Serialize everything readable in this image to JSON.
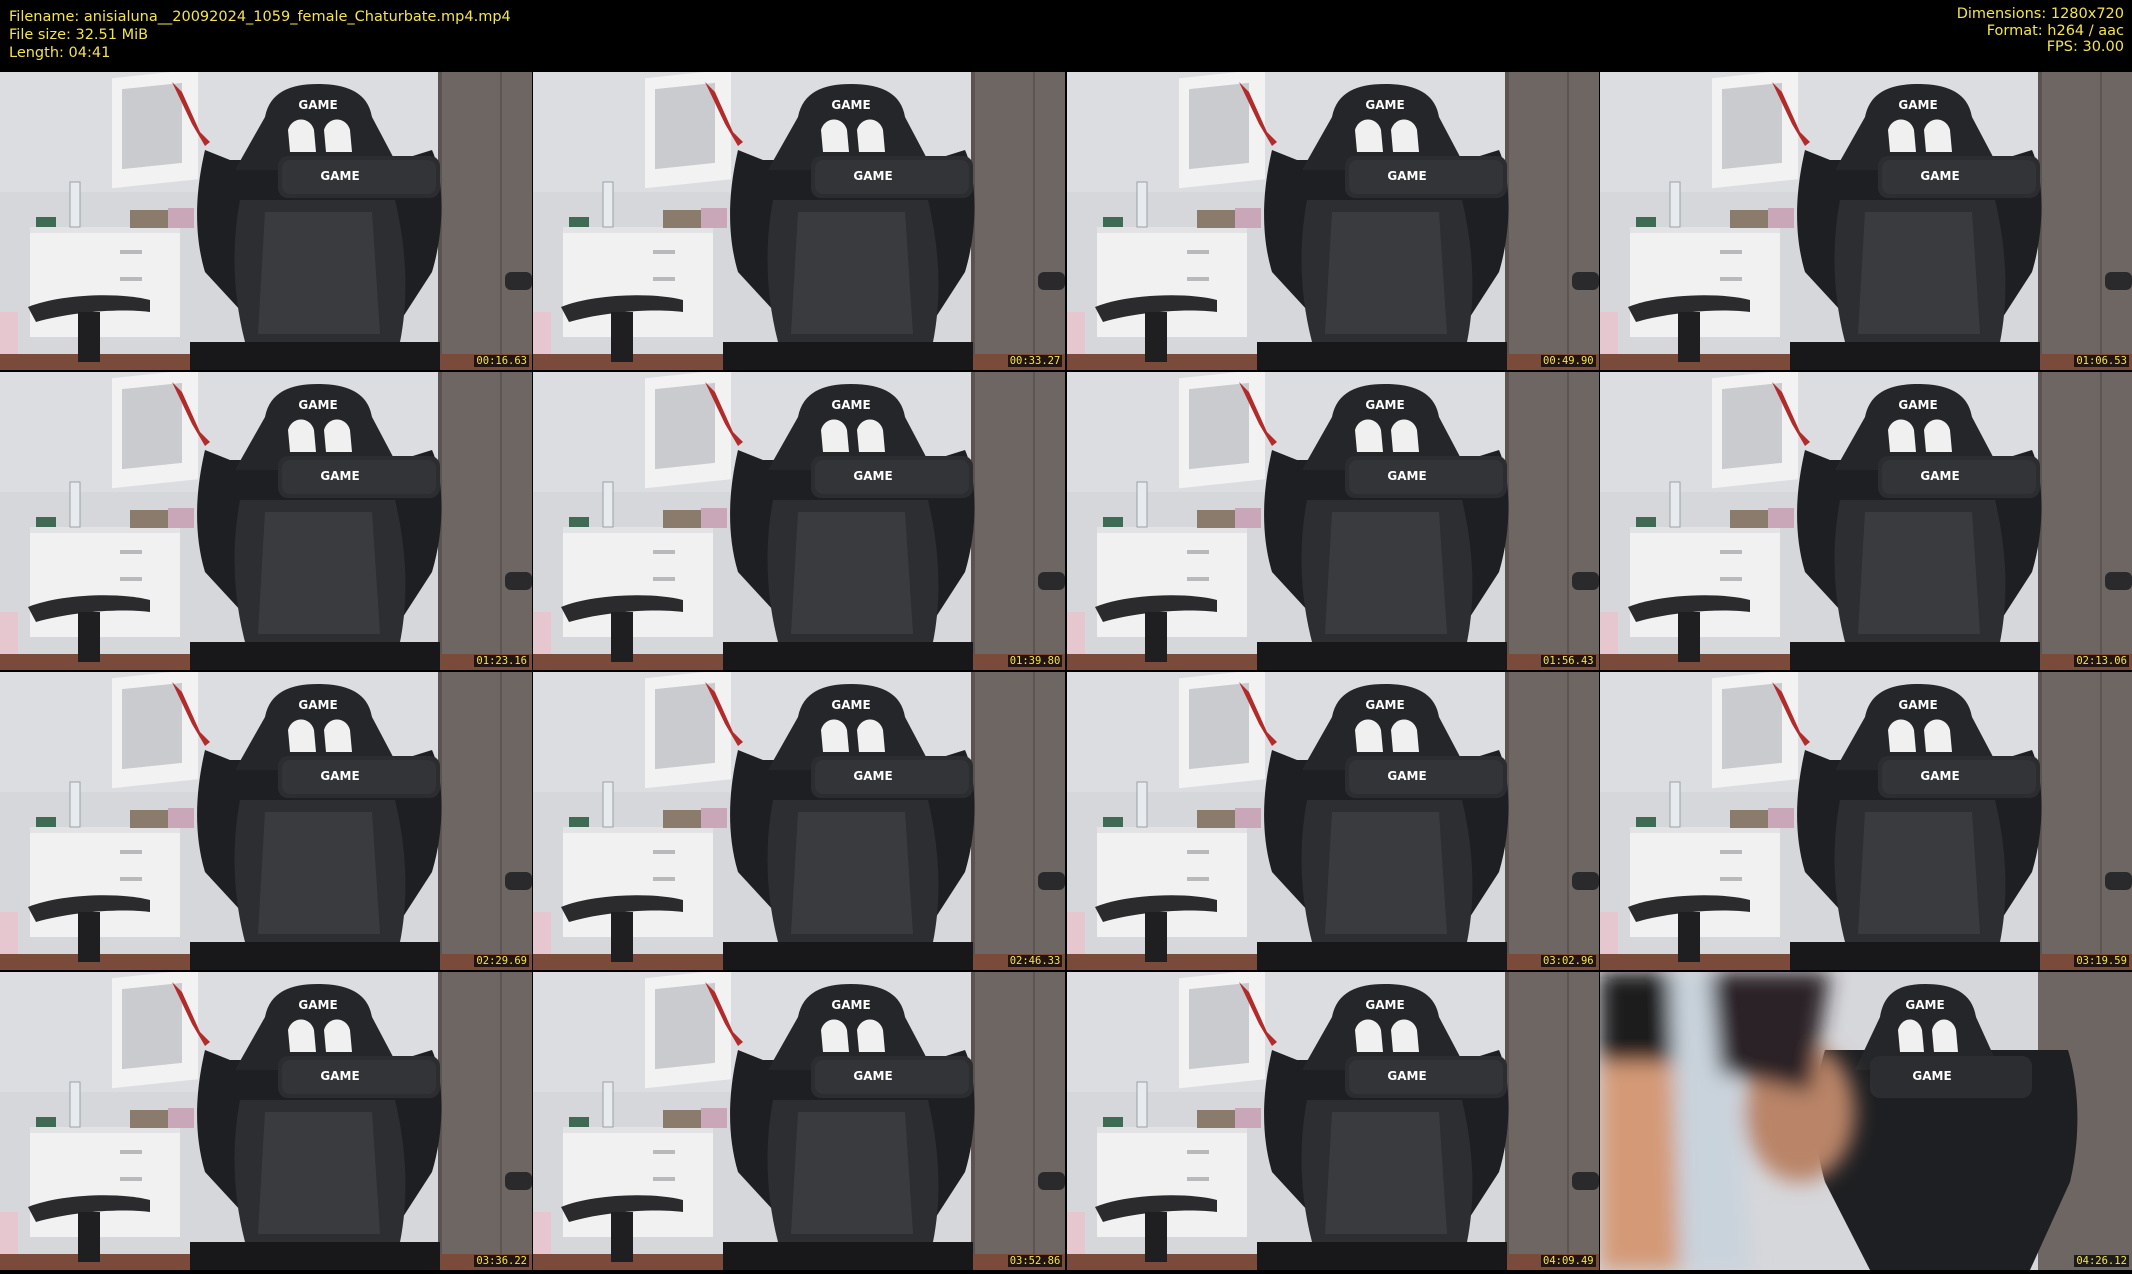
{
  "header": {
    "filename": "Filename: anisialuna__20092024_1059_female_Chaturbate.mp4.mp4",
    "filesize": "File size: 32.51 MiB",
    "length": "Length: 04:41",
    "dimensions": "Dimensions: 1280x720",
    "format": "Format: h264 / aac",
    "fps": "FPS: 30.00"
  },
  "frames": [
    {
      "time": "00:16.63",
      "variant": "chair"
    },
    {
      "time": "00:33.27",
      "variant": "chair"
    },
    {
      "time": "00:49.90",
      "variant": "chair"
    },
    {
      "time": "01:06.53",
      "variant": "chair"
    },
    {
      "time": "01:23.16",
      "variant": "chair"
    },
    {
      "time": "01:39.80",
      "variant": "chair"
    },
    {
      "time": "01:56.43",
      "variant": "chair"
    },
    {
      "time": "02:13.06",
      "variant": "chair"
    },
    {
      "time": "02:29.69",
      "variant": "chair"
    },
    {
      "time": "02:46.33",
      "variant": "chair"
    },
    {
      "time": "03:02.96",
      "variant": "chair"
    },
    {
      "time": "03:19.59",
      "variant": "chair"
    },
    {
      "time": "03:36.22",
      "variant": "chair"
    },
    {
      "time": "03:52.86",
      "variant": "chair"
    },
    {
      "time": "04:09.49",
      "variant": "chair"
    },
    {
      "time": "04:26.12",
      "variant": "blur"
    }
  ],
  "chair_text": {
    "top": "GAME",
    "pillow": "GAME"
  },
  "colors": {
    "meta_text": "#f3e44c",
    "background": "#000000",
    "timestamp_text": "#f3e44c"
  }
}
